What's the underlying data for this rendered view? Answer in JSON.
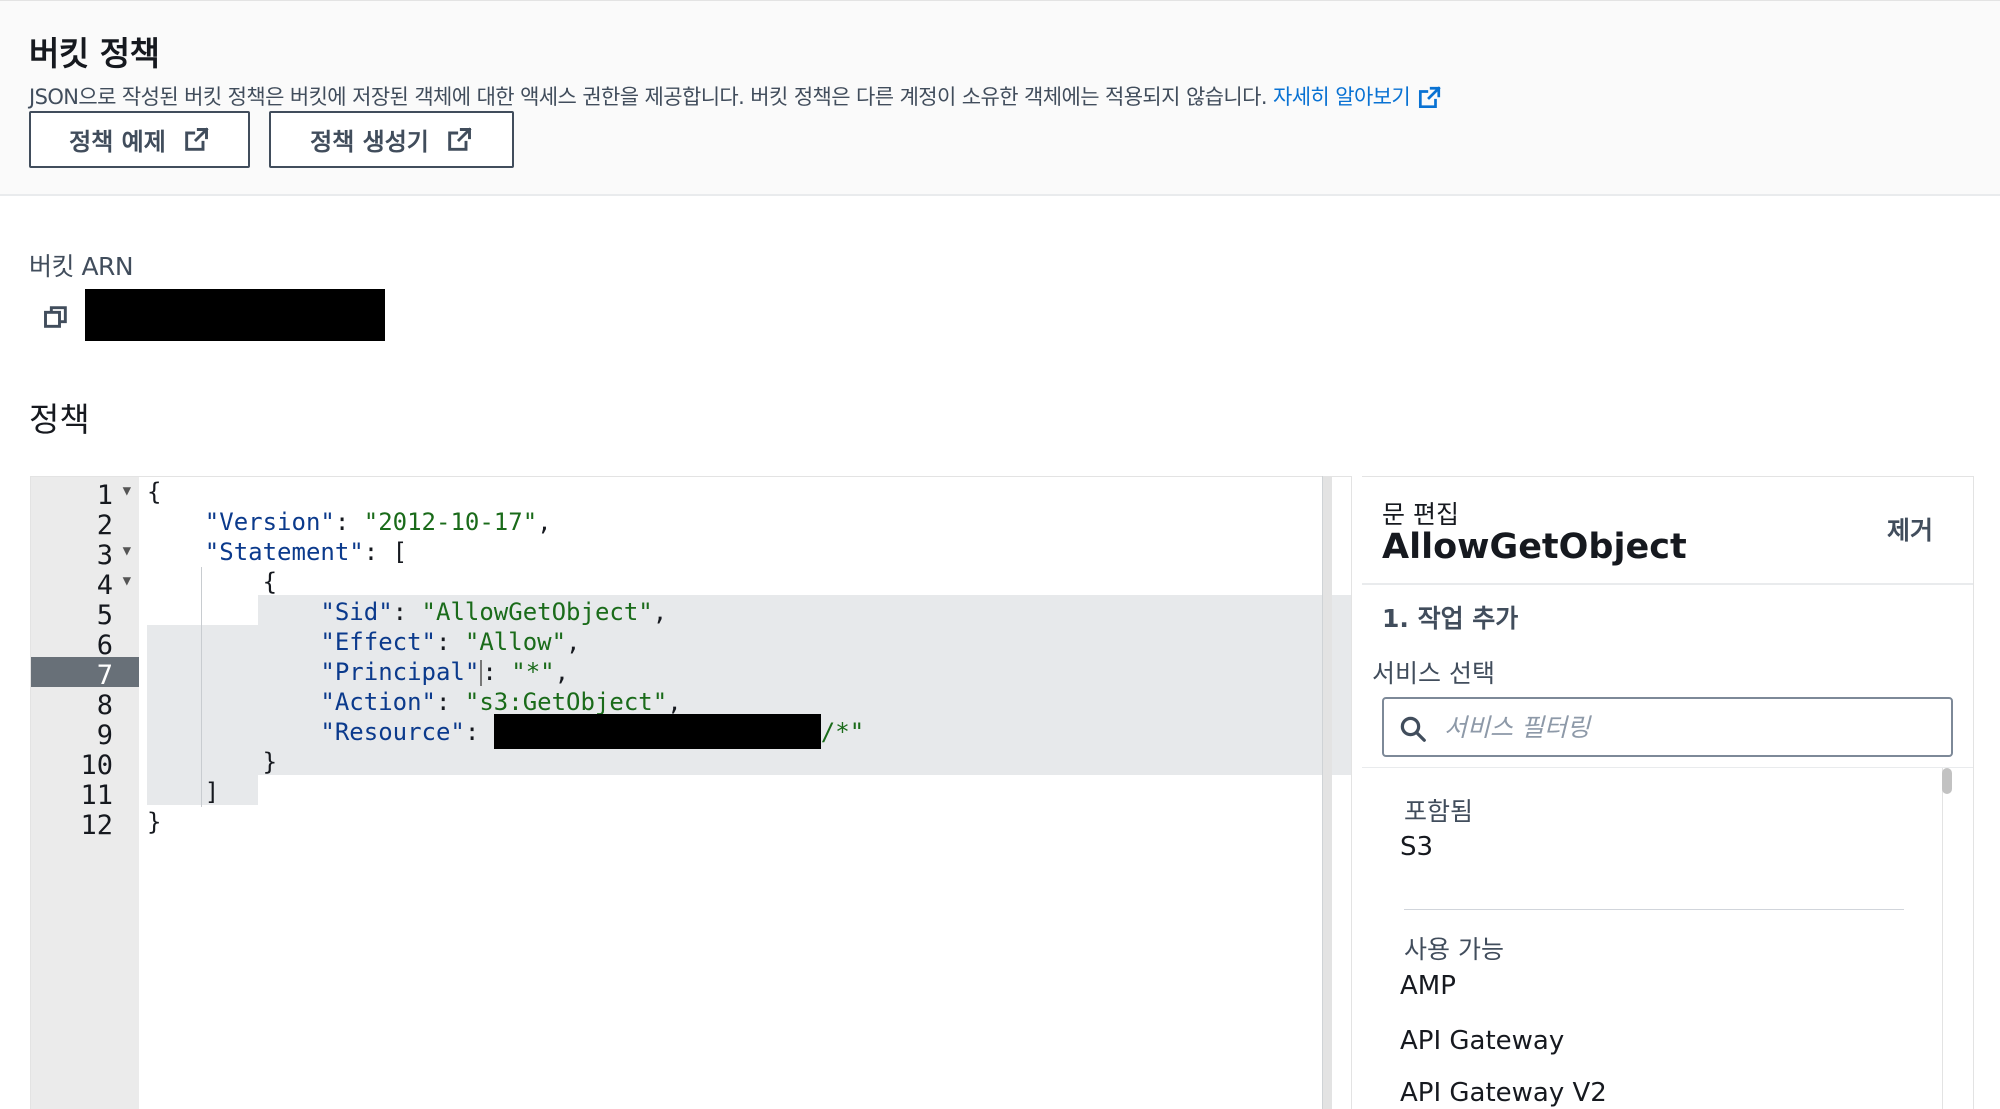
{
  "header": {
    "title": "버킷 정책",
    "description": "JSON으로 작성된 버킷 정책은 버킷에 저장된 객체에 대한 액세스 권한을 제공합니다. 버킷 정책은 다른 계정이 소유한 객체에는 적용되지 않습니다.",
    "learn_more": "자세히 알아보기",
    "buttons": {
      "policy_examples": "정책 예제",
      "policy_generator": "정책 생성기"
    }
  },
  "arn": {
    "label": "버킷 ARN"
  },
  "policy": {
    "label": "정책"
  },
  "editor": {
    "line_numbers": [
      "1",
      "2",
      "3",
      "4",
      "5",
      "6",
      "7",
      "8",
      "9",
      "10",
      "11",
      "12"
    ],
    "active_line": "7",
    "code": {
      "l1": "{",
      "version_key": "\"Version\"",
      "version_value": "\"2012-10-17\"",
      "statement_key": "\"Statement\"",
      "bracket_open": "[",
      "brace_open": "{",
      "sid_key": "\"Sid\"",
      "sid_value": "\"AllowGetObject\"",
      "effect_key": "\"Effect\"",
      "effect_value": "\"Allow\"",
      "principal_key": "\"Principal\"",
      "principal_value": "\"*\"",
      "action_key": "\"Action\"",
      "action_value": "\"s3:GetObject\"",
      "resource_key": "\"Resource\"",
      "resource_suffix": "/*\"",
      "brace_close": "}",
      "bracket_close": "]",
      "l12": "}"
    }
  },
  "side_panel": {
    "subtitle": "문 편집",
    "statement_name": "AllowGetObject",
    "remove": "제거",
    "step": "1. 작업 추가",
    "service_label": "서비스 선택",
    "search_placeholder": "서비스 필터링",
    "included_heading": "포함됨",
    "included": [
      "S3"
    ],
    "available_heading": "사용 가능",
    "available": [
      "AMP",
      "API Gateway",
      "API Gateway V2"
    ]
  },
  "colors": {
    "link": "#0972d3",
    "key": "#0b3a8c",
    "string": "#1a6b1a",
    "active_line": "#687078"
  }
}
